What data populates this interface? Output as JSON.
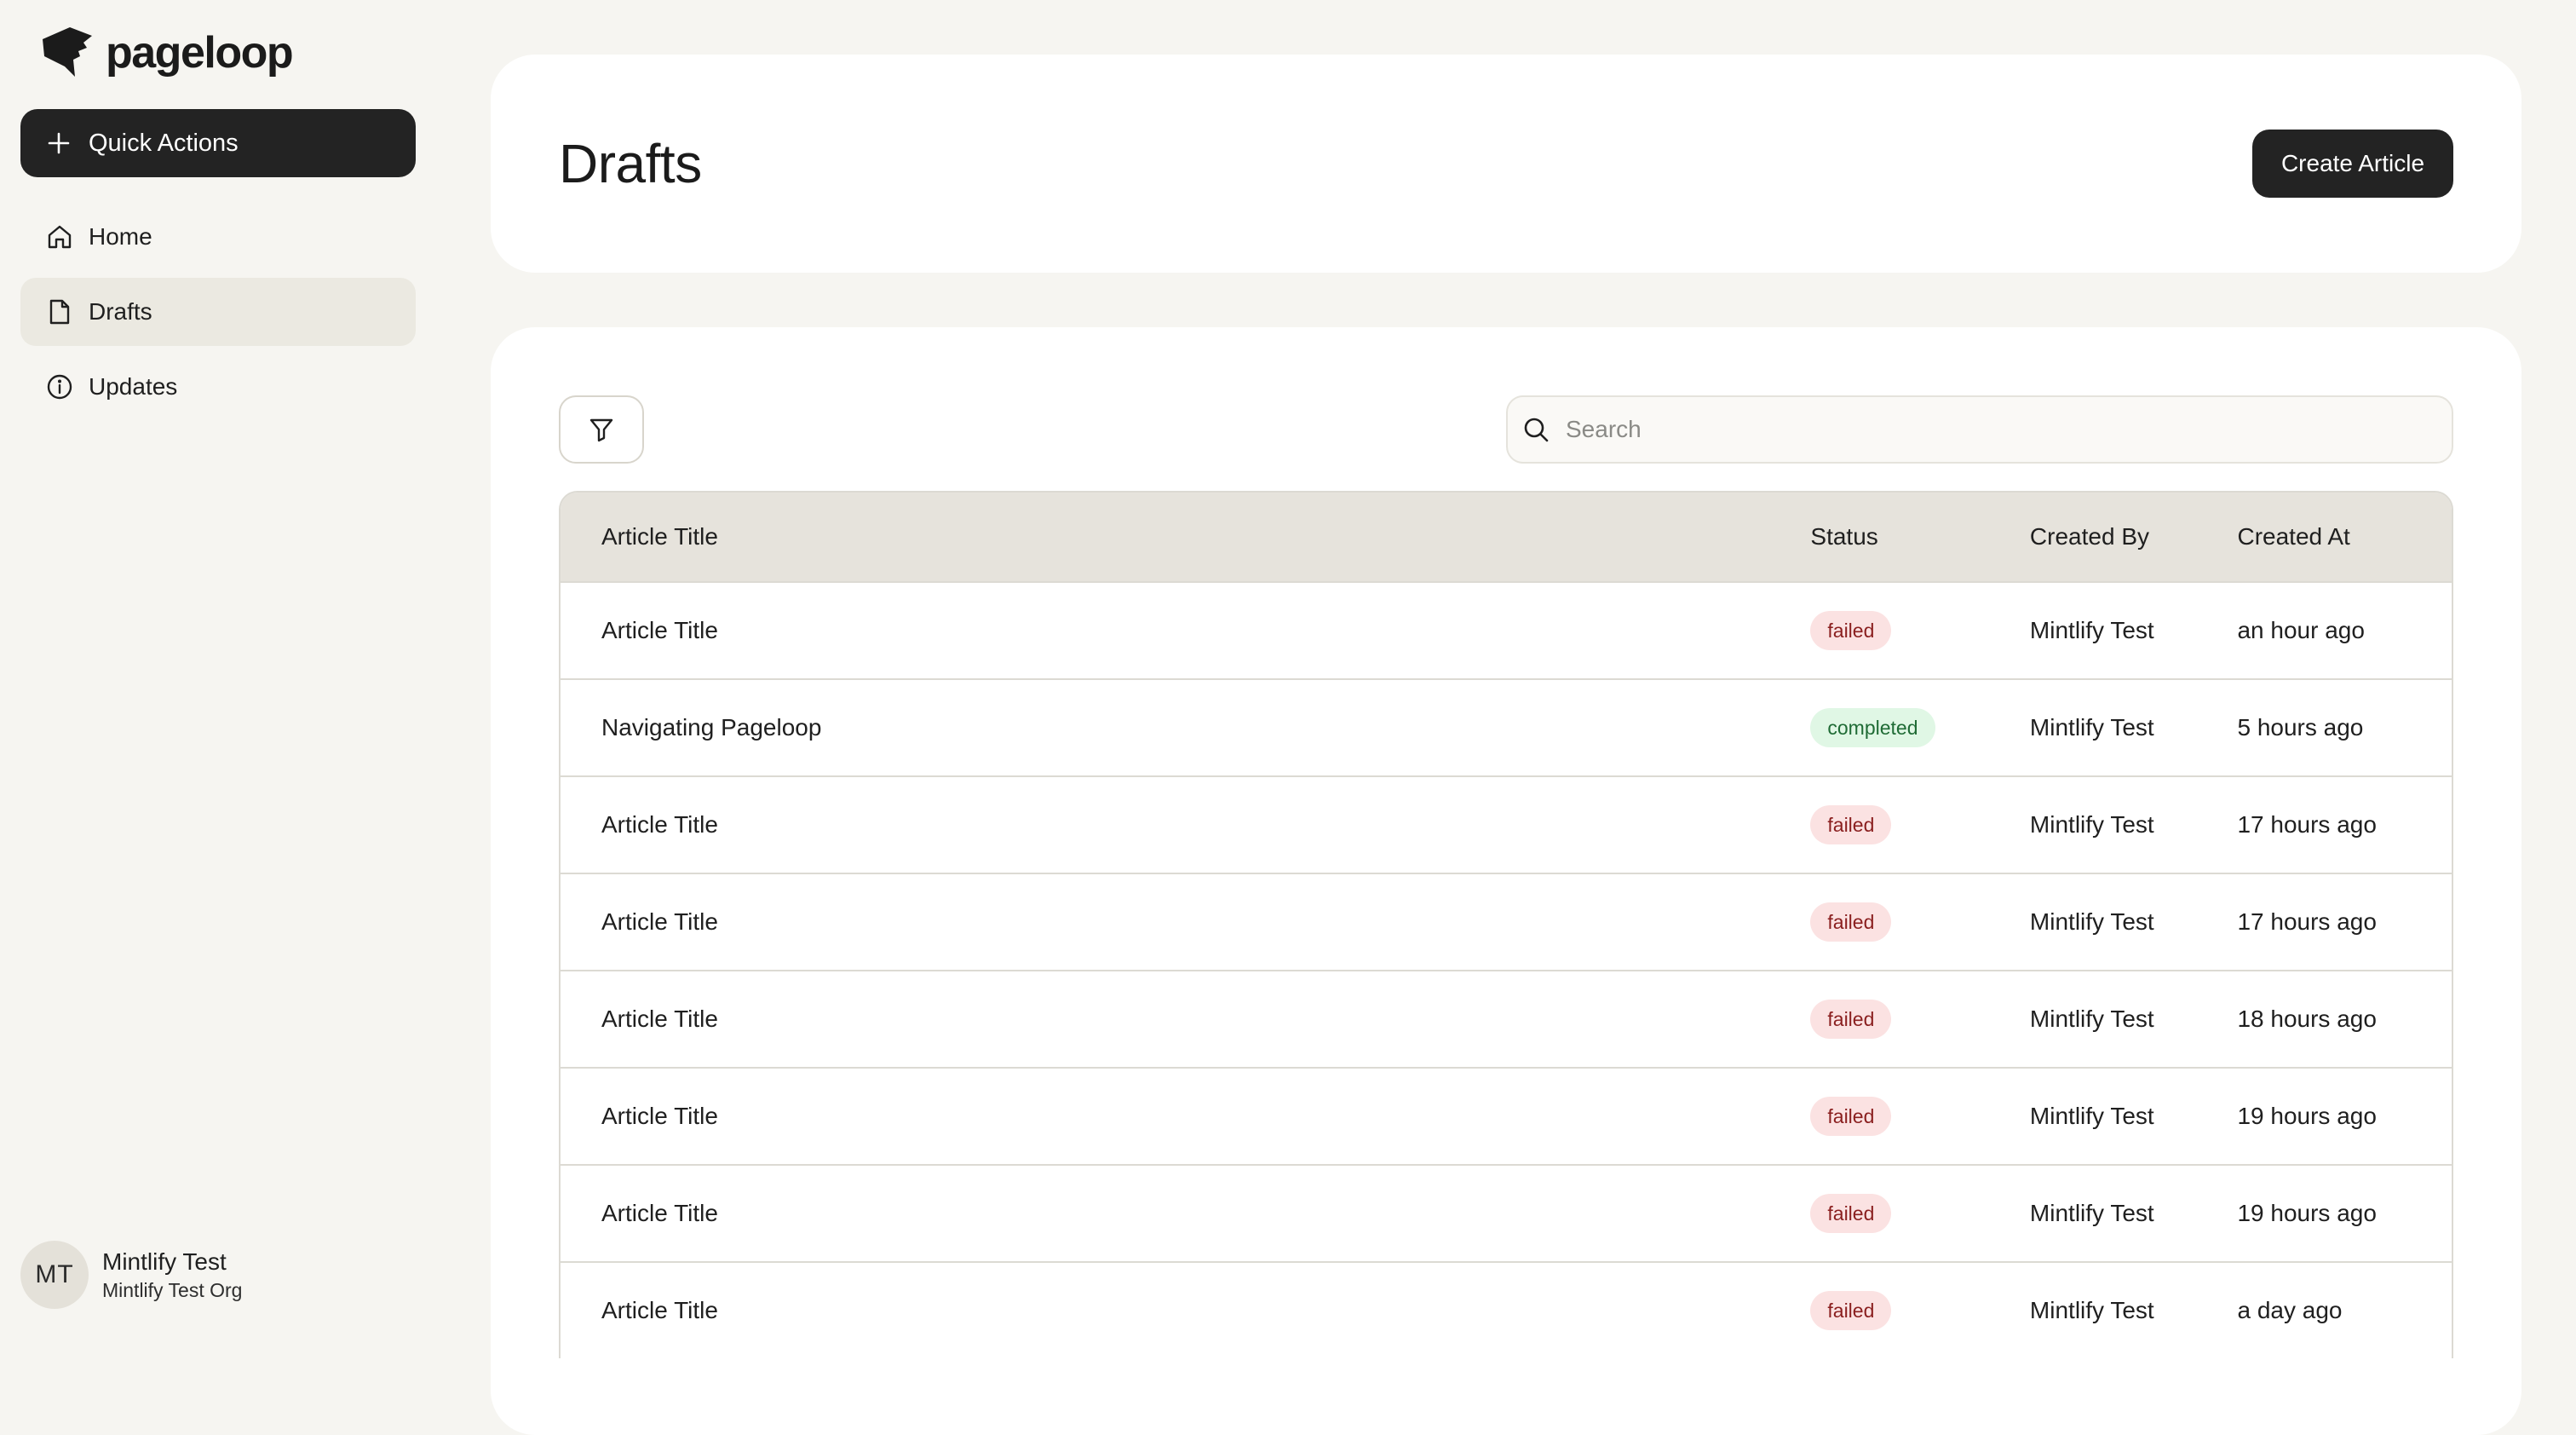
{
  "brand": {
    "name": "pageloop"
  },
  "sidebar": {
    "quick_actions_label": "Quick Actions",
    "items": [
      {
        "label": "Home",
        "icon": "home-icon",
        "active": false
      },
      {
        "label": "Drafts",
        "icon": "document-icon",
        "active": true
      },
      {
        "label": "Updates",
        "icon": "info-icon",
        "active": false
      }
    ],
    "user": {
      "initials": "MT",
      "name": "Mintlify Test",
      "org": "Mintlify Test Org"
    }
  },
  "header": {
    "title": "Drafts",
    "create_button_label": "Create Article"
  },
  "toolbar": {
    "filter_icon": "filter-icon",
    "search_placeholder": "Search",
    "search_value": ""
  },
  "table": {
    "columns": [
      "Article Title",
      "Status",
      "Created By",
      "Created At"
    ],
    "rows": [
      {
        "title": "Article Title",
        "status": "failed",
        "created_by": "Mintlify Test",
        "created_at": "an hour ago"
      },
      {
        "title": "Navigating Pageloop",
        "status": "completed",
        "created_by": "Mintlify Test",
        "created_at": "5 hours ago"
      },
      {
        "title": "Article Title",
        "status": "failed",
        "created_by": "Mintlify Test",
        "created_at": "17 hours ago"
      },
      {
        "title": "Article Title",
        "status": "failed",
        "created_by": "Mintlify Test",
        "created_at": "17 hours ago"
      },
      {
        "title": "Article Title",
        "status": "failed",
        "created_by": "Mintlify Test",
        "created_at": "18 hours ago"
      },
      {
        "title": "Article Title",
        "status": "failed",
        "created_by": "Mintlify Test",
        "created_at": "19 hours ago"
      },
      {
        "title": "Article Title",
        "status": "failed",
        "created_by": "Mintlify Test",
        "created_at": "19 hours ago"
      },
      {
        "title": "Article Title",
        "status": "failed",
        "created_by": "Mintlify Test",
        "created_at": "a day ago"
      }
    ]
  },
  "colors": {
    "background": "#f6f5f1",
    "primary_button": "#232323",
    "active_nav": "#ebe9e1",
    "table_header": "#e6e3dc",
    "failed_bg": "#fbe2e2",
    "failed_text": "#8a1f1f",
    "completed_bg": "#e0f7e5",
    "completed_text": "#1f6b35"
  }
}
